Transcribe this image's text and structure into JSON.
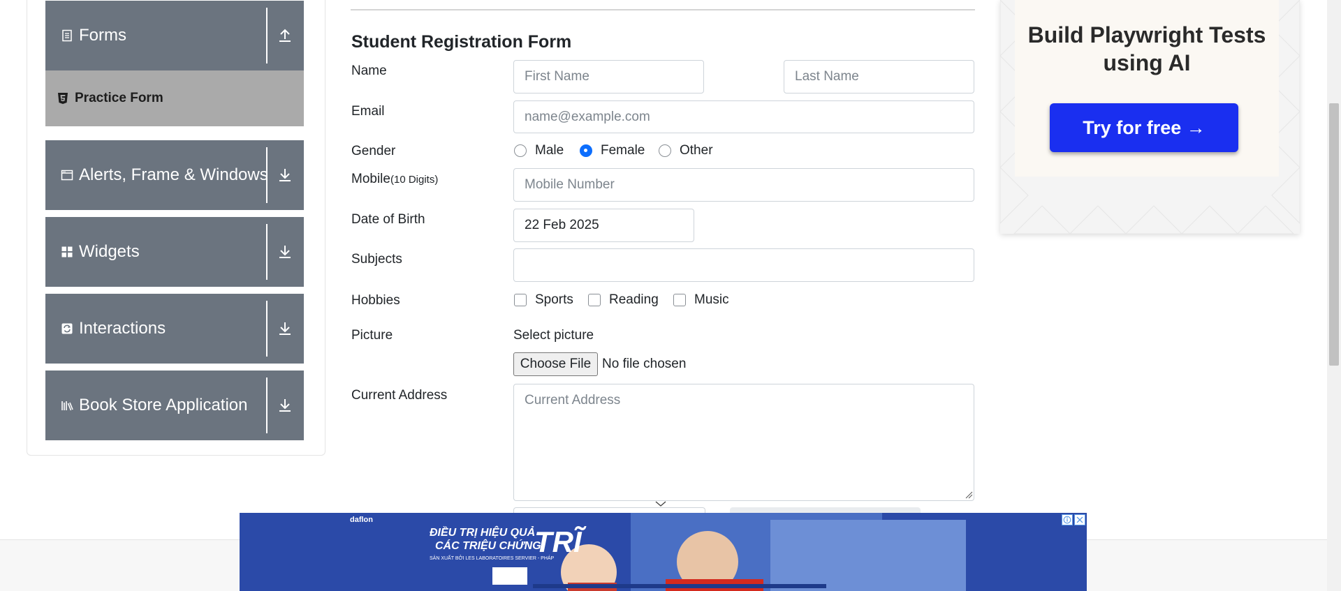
{
  "sidebar": {
    "groups": [
      {
        "label": "Forms",
        "icon": "document-icon",
        "arrow": "upload-arrow-icon"
      },
      {
        "label": "Alerts, Frame & Windows",
        "icon": "window-icon",
        "arrow": "download-arrow-icon"
      },
      {
        "label": "Widgets",
        "icon": "widgets-icon",
        "arrow": "download-arrow-icon"
      },
      {
        "label": "Interactions",
        "icon": "interactions-icon",
        "arrow": "download-arrow-icon"
      },
      {
        "label": "Book Store Application",
        "icon": "books-icon",
        "arrow": "download-arrow-icon"
      }
    ],
    "active_item": {
      "label": "Practice Form",
      "icon": "html5-icon"
    },
    "group_color": "#6b747f",
    "active_item_color": "#aaaaaa"
  },
  "form": {
    "title": "Student Registration Form",
    "name_label": "Name",
    "first_name_placeholder": "First Name",
    "last_name_placeholder": "Last Name",
    "email_label": "Email",
    "email_placeholder": "name@example.com",
    "gender_label": "Gender",
    "gender_options": [
      "Male",
      "Female",
      "Other"
    ],
    "gender_selected": "Female",
    "mobile_label": "Mobile",
    "mobile_hint": "(10 Digits)",
    "mobile_placeholder": "Mobile Number",
    "dob_label": "Date of Birth",
    "dob_value": "22 Feb 2025",
    "subjects_label": "Subjects",
    "subjects_value": "",
    "hobbies_label": "Hobbies",
    "hobbies_options": [
      "Sports",
      "Reading",
      "Music"
    ],
    "picture_label": "Picture",
    "select_picture_label": "Select picture",
    "choose_file_label": "Choose File",
    "file_status": "No file chosen",
    "address_label": "Current Address",
    "address_placeholder": "Current Address",
    "accent_color": "#0d6efd"
  },
  "ad_right": {
    "headline": "Build Playwright Tests using AI",
    "cta": "Try for free →",
    "cta_color": "#1a2ff0"
  },
  "ad_bottom": {
    "brand": "daflon",
    "line1": "ĐIỀU TRỊ HIỆU QUẢ",
    "line2": "CÁC TRIỆU CHỨNG",
    "line3": "TRĨ",
    "line4": "SẢN XUẤT BỞI LES LABORATOIRES SERVIER - PHÁP",
    "background_color": "#2b4aa8",
    "controls": [
      "adchoices-icon",
      "close-icon"
    ]
  }
}
